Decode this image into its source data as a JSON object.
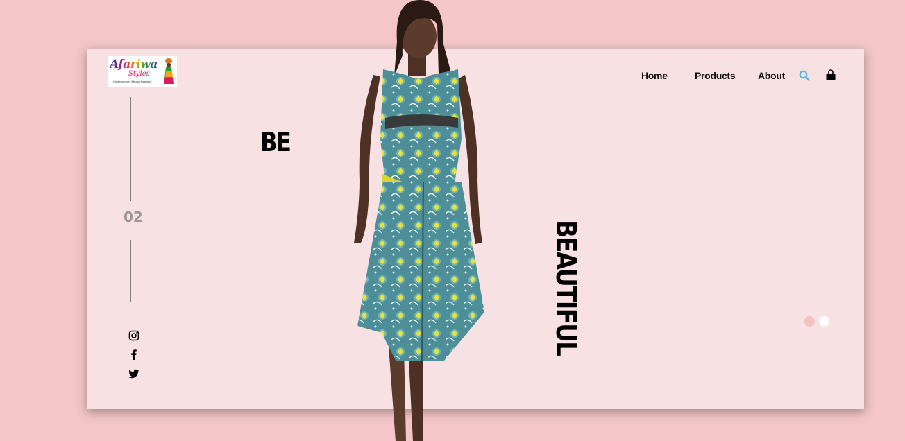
{
  "brand": {
    "logo_text": "Afariwa",
    "logo_sub": "Styles",
    "logo_tagline": "Contemporary African Fashion"
  },
  "nav": {
    "items": [
      {
        "label": "Home"
      },
      {
        "label": "Products"
      },
      {
        "label": "About"
      }
    ],
    "search_icon": "search-icon",
    "cart_icon": "shopping-bag-icon"
  },
  "hero": {
    "word_1": "BE",
    "word_2": "BEAUTIFUL",
    "slide_number": "02",
    "active_slide": 2,
    "total_slides": 2
  },
  "social": [
    {
      "icon": "instagram-icon"
    },
    {
      "icon": "facebook-icon"
    },
    {
      "icon": "twitter-icon"
    }
  ],
  "colors": {
    "background": "#f4c6c8",
    "card": "#f8e1e2",
    "accent_search": "#5ab4e5",
    "dot_inactive": "#f4c1c3",
    "dot_active": "#ffffff"
  }
}
